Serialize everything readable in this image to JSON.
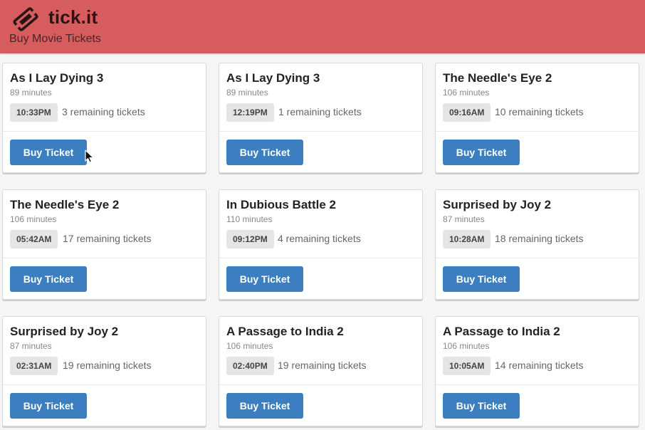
{
  "header": {
    "brand": "tick.it",
    "tagline": "Buy Movie Tickets",
    "logo_icon": "ticket-icon",
    "background": "#d65c5d"
  },
  "colors": {
    "button": "#3b7fc0",
    "badge": "#e5e5e5"
  },
  "movies": [
    {
      "title": "As I Lay Dying 3",
      "duration": "89 minutes",
      "time": "10:33PM",
      "remaining": "3 remaining tickets",
      "button": "Buy Ticket"
    },
    {
      "title": "As I Lay Dying 3",
      "duration": "89 minutes",
      "time": "12:19PM",
      "remaining": "1 remaining tickets",
      "button": "Buy Ticket"
    },
    {
      "title": "The Needle's Eye 2",
      "duration": "106 minutes",
      "time": "09:16AM",
      "remaining": "10 remaining tickets",
      "button": "Buy Ticket"
    },
    {
      "title": "The Needle's Eye 2",
      "duration": "106 minutes",
      "time": "05:42AM",
      "remaining": "17 remaining tickets",
      "button": "Buy Ticket"
    },
    {
      "title": "In Dubious Battle 2",
      "duration": "110 minutes",
      "time": "09:12PM",
      "remaining": "4 remaining tickets",
      "button": "Buy Ticket"
    },
    {
      "title": "Surprised by Joy 2",
      "duration": "87 minutes",
      "time": "10:28AM",
      "remaining": "18 remaining tickets",
      "button": "Buy Ticket"
    },
    {
      "title": "Surprised by Joy 2",
      "duration": "87 minutes",
      "time": "02:31AM",
      "remaining": "19 remaining tickets",
      "button": "Buy Ticket"
    },
    {
      "title": "A Passage to India 2",
      "duration": "106 minutes",
      "time": "02:40PM",
      "remaining": "19 remaining tickets",
      "button": "Buy Ticket"
    },
    {
      "title": "A Passage to India 2",
      "duration": "106 minutes",
      "time": "10:05AM",
      "remaining": "14 remaining tickets",
      "button": "Buy Ticket"
    }
  ]
}
